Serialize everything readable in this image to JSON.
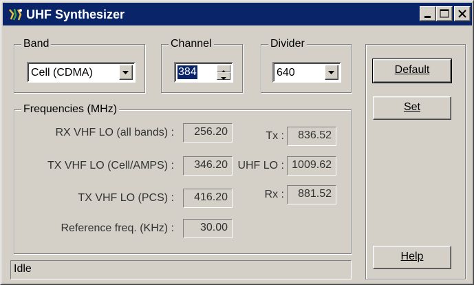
{
  "window": {
    "title": "UHF Synthesizer"
  },
  "band": {
    "label": "Band",
    "selected": "Cell (CDMA)"
  },
  "channel": {
    "label": "Channel",
    "value": "384"
  },
  "divider": {
    "label": "Divider",
    "selected": "640"
  },
  "frequencies": {
    "label": "Frequencies (MHz)",
    "rows": [
      {
        "label": "RX VHF LO (all bands) :",
        "value": "256.20"
      },
      {
        "label": "TX VHF LO (Cell/AMPS) :",
        "value": "346.20"
      },
      {
        "label": "TX VHF LO (PCS) :",
        "value": "416.20"
      },
      {
        "label": "Reference freq. (KHz)  :",
        "value": "30.00"
      }
    ],
    "right": [
      {
        "label": "Tx :",
        "value": "836.52"
      },
      {
        "label": "UHF LO :",
        "value": "1009.62"
      },
      {
        "label": "Rx :",
        "value": "881.52"
      }
    ]
  },
  "buttons": {
    "default_label": "Default",
    "set_label": "Set",
    "help_label": "Help"
  },
  "status": "Idle",
  "icons": {
    "app": "app-icon",
    "minimize": "minimize-icon",
    "maximize": "maximize-icon",
    "close": "close-icon"
  }
}
